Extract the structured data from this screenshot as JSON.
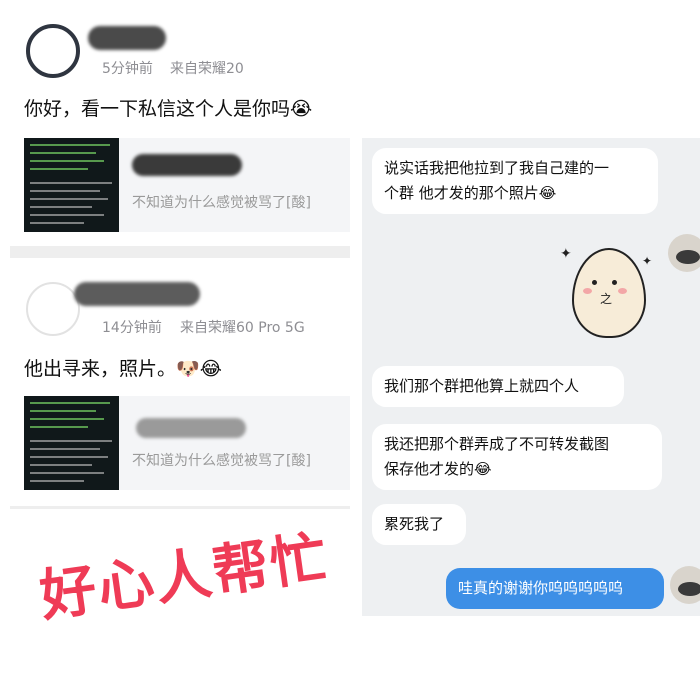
{
  "feed": {
    "post1": {
      "time": "5分钟前",
      "source": "来自荣耀20",
      "text": "你好，看一下私信这个人是你吗",
      "emoji": "😭",
      "quote_text": "不知道为什么感觉被骂了[酸]"
    },
    "post2": {
      "time": "14分钟前",
      "source": "来自荣耀60 Pro 5G",
      "text": "他出寻来，照片。",
      "emoji1": "🐶",
      "emoji2": "😂",
      "quote_text": "不知道为什么感觉被骂了[酸]"
    }
  },
  "chat": {
    "messages": [
      {
        "line1": "说实话我把他拉到了我自己建的一",
        "line2": "个群   他才发的那个照片😂"
      },
      {
        "line1": "我们那个群把他算上就四个人"
      },
      {
        "line1": "我还把那个群弄成了不可转发截图",
        "line2": "保存他才发的😂"
      },
      {
        "line1": "累死我了"
      },
      {
        "line1": "哇真的谢谢你呜呜呜呜呜"
      }
    ]
  },
  "overlay": {
    "text": "好心人帮忙"
  },
  "colors": {
    "accent_blue": "#3d8fe6",
    "overlay_red": "#ef3b56"
  }
}
